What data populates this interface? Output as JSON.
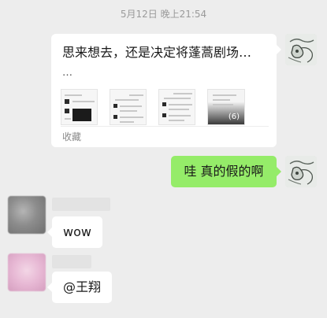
{
  "timestamp": "5月12日 晚上21:54",
  "card": {
    "title": "思来想去，还是决定将蓬蒿剧场…",
    "ellipsis": "…",
    "extra_count": "(6)",
    "footer": "收藏"
  },
  "messages": {
    "outgoing_text": "哇 真的假的啊",
    "incoming_1_text": "wow",
    "incoming_2_text": "@王翔"
  },
  "colors": {
    "background": "#ededed",
    "outgoing_bubble": "#95ec69",
    "incoming_bubble": "#ffffff",
    "avatar_1": "#8c8c8c",
    "avatar_2": "#e7b8d4"
  }
}
